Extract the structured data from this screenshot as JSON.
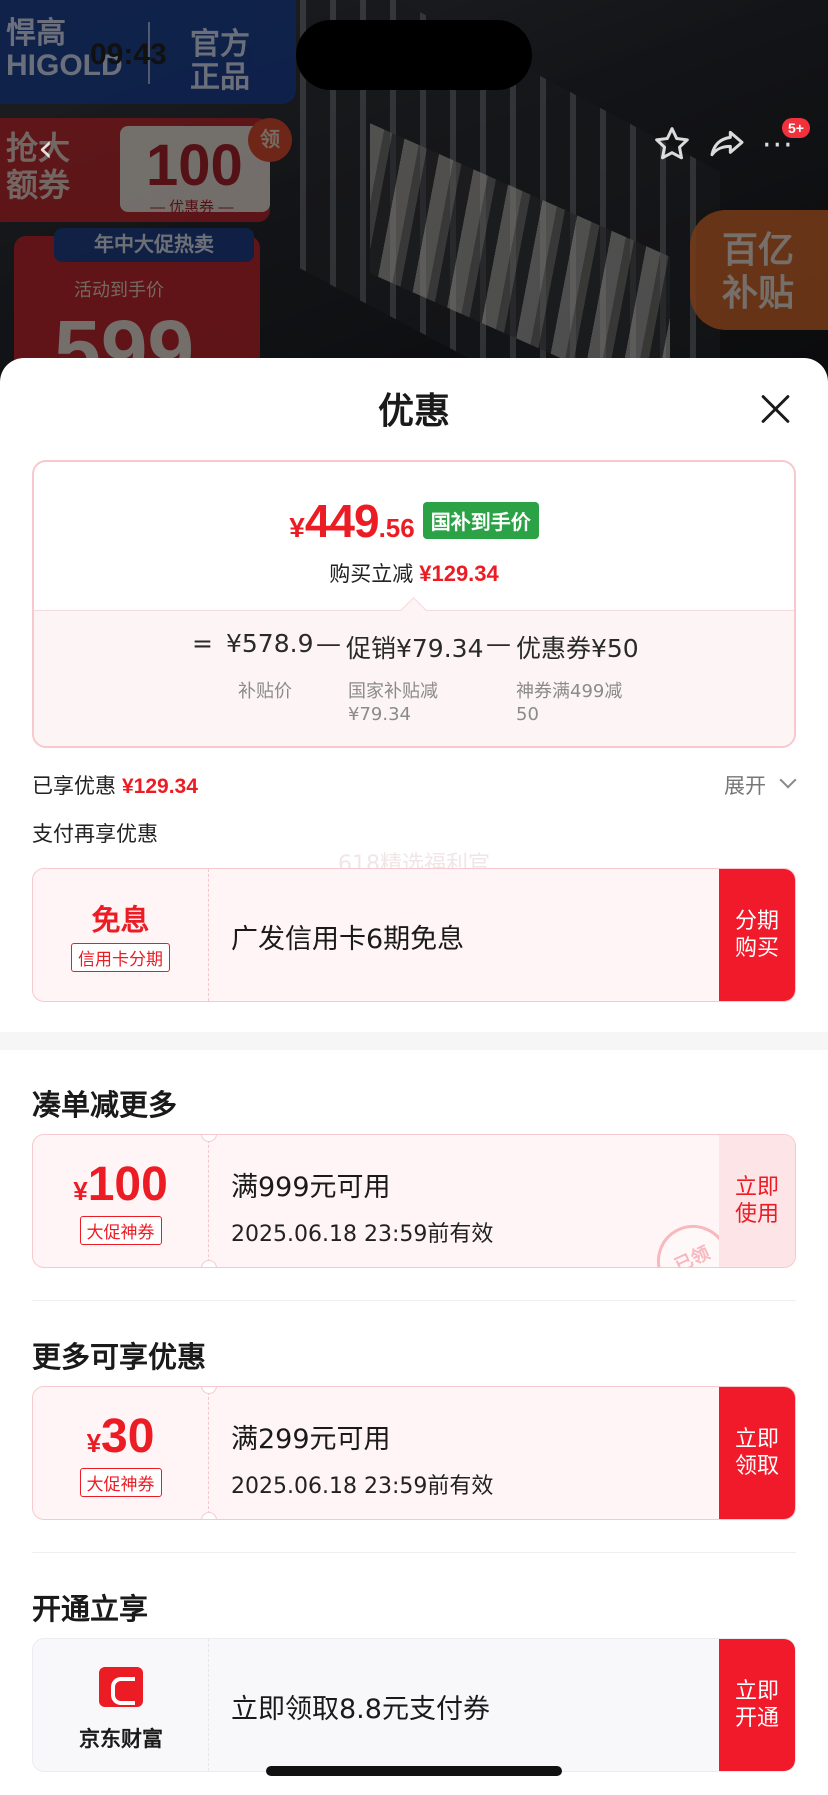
{
  "status": {
    "time": "09:43"
  },
  "background": {
    "brand_cn": "悍高",
    "brand_en": "HIGOLD",
    "official_line1": "官方",
    "official_line2": "正品",
    "coupon_ad_line1": "抢大",
    "coupon_ad_line2": "额券",
    "coupon_ad_amount": "100",
    "coupon_ad_label": "— 优惠券 —",
    "coupon_ad_badge": "领",
    "promo_banner": "年中大促热卖",
    "promo_label": "活动到手价",
    "promo_price": "599",
    "subsidy_line1": "百亿",
    "subsidy_line2": "补贴",
    "cart_badge": "5+"
  },
  "sheet": {
    "title": "优惠",
    "price": {
      "yen": "¥",
      "integer": "449",
      "decimal": ".56",
      "tag": "国补到手价",
      "reduce_label": "购买立减",
      "reduce_amount": "¥129.34"
    },
    "calc": {
      "equals": "=",
      "base": "¥578.9",
      "base_label": "补贴价",
      "minus1": "—",
      "promo": "促销¥79.34",
      "promo_label_1": "国家补贴减",
      "promo_label_2": "¥79.34",
      "minus2": "—",
      "coupon": "优惠券¥50",
      "coupon_label_1": "神券满499减",
      "coupon_label_2": "50"
    },
    "enjoyed_label": "已享优惠",
    "enjoyed_amount": "¥129.34",
    "expand_label": "展开",
    "pay_label": "支付再享优惠",
    "watermark": "618精选福利官",
    "installment": {
      "big": "免息",
      "tag": "信用卡分期",
      "title": "广发信用卡6期免息",
      "action_1": "分期",
      "action_2": "购买"
    },
    "section_more_order": "凑单减更多",
    "coupon1": {
      "yen": "¥",
      "amount": "100",
      "tag": "大促神券",
      "title": "满999元可用",
      "expiry": "2025.06.18 23:59前有效",
      "action_1": "立即",
      "action_2": "使用",
      "stamp": "已领"
    },
    "section_more_discount": "更多可享优惠",
    "coupon2": {
      "yen": "¥",
      "amount": "30",
      "tag": "大促神券",
      "title": "满299元可用",
      "expiry": "2025.06.18 23:59前有效",
      "action_1": "立即",
      "action_2": "领取"
    },
    "section_open": "开通立享",
    "jd": {
      "name": "京东财富",
      "title": "立即领取8.8元支付券",
      "action_1": "立即",
      "action_2": "开通"
    }
  }
}
